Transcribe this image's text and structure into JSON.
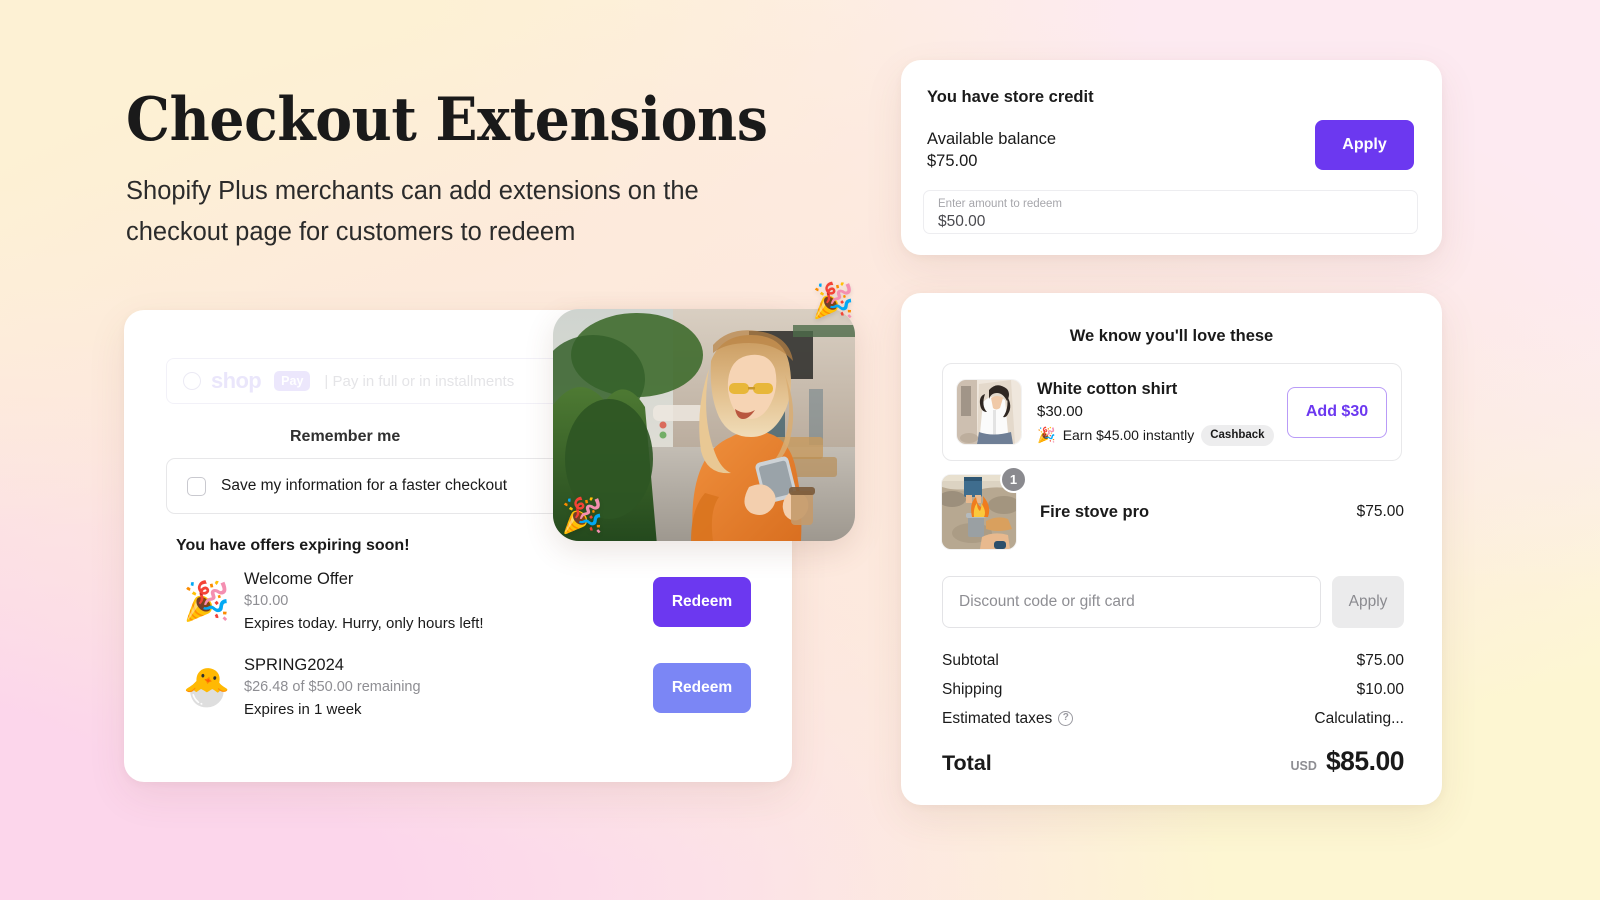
{
  "hero": {
    "title": "Checkout Extensions",
    "subtitle": "Shopify Plus merchants can add extensions on the checkout page for customers to redeem"
  },
  "colors": {
    "accent_purple": "#6c38f0",
    "accent_purple_light": "#7b86f5",
    "add_button_border": "#b99bf7",
    "chip_grey": "#ededee",
    "badge_grey": "#8a8a8f"
  },
  "store_credit": {
    "title": "You have store credit",
    "balance_label": "Available balance",
    "balance_value": "$75.00",
    "apply_label": "Apply",
    "input_label": "Enter amount to redeem",
    "input_value": "$50.00"
  },
  "checkout": {
    "shop_pay": {
      "radio_icon": "radio-unselected-icon",
      "brand": "shop",
      "chip": "Pay",
      "note": "| Pay in full or in installments"
    },
    "remember_me_label": "Remember me",
    "save_info_label": "Save my information for a faster checkout",
    "save_info_checkbox_icon": "checkbox-unchecked-icon",
    "offers_title": "You have offers expiring soon!",
    "offers": [
      {
        "emoji": "🎉",
        "emoji_name": "party-popper-icon",
        "name": "Welcome Offer",
        "amount": "$10.00",
        "expiry": "Expires today. Hurry, only hours left!",
        "button_label": "Redeem",
        "button_color": "#6c38f0"
      },
      {
        "emoji": "🐣",
        "emoji_name": "hatching-chick-icon",
        "name": "SPRING2024",
        "amount": "$26.48 of $50.00 remaining",
        "expiry": "Expires in 1 week",
        "button_label": "Redeem",
        "button_color": "#7b86f5"
      }
    ]
  },
  "hero_photo": {
    "alt": "Woman in orange sweater using a phone on a city street",
    "popper_emoji": "🎉"
  },
  "summary": {
    "title": "We know you'll love these",
    "recommendation": {
      "thumbnail_alt": "Woman wearing a white cotton shirt",
      "name": "White cotton shirt",
      "price": "$30.00",
      "earn_emoji": "🎉",
      "earn_text": "Earn $45.00 instantly",
      "chip": "Cashback",
      "button_label": "Add $30"
    },
    "cart_item": {
      "thumbnail_alt": "Fire stove pro burning outdoors",
      "quantity": "1",
      "name": "Fire stove pro",
      "price": "$75.00"
    },
    "discount": {
      "placeholder": "Discount code or gift card",
      "value": "",
      "apply_label": "Apply"
    },
    "totals": [
      {
        "label": "Subtotal",
        "value": "$75.00",
        "has_info_icon": false
      },
      {
        "label": "Shipping",
        "value": "$10.00",
        "has_info_icon": false
      },
      {
        "label": "Estimated taxes",
        "value": "Calculating...",
        "has_info_icon": true
      }
    ],
    "grand_total": {
      "label": "Total",
      "currency": "USD",
      "value": "$85.00"
    }
  }
}
